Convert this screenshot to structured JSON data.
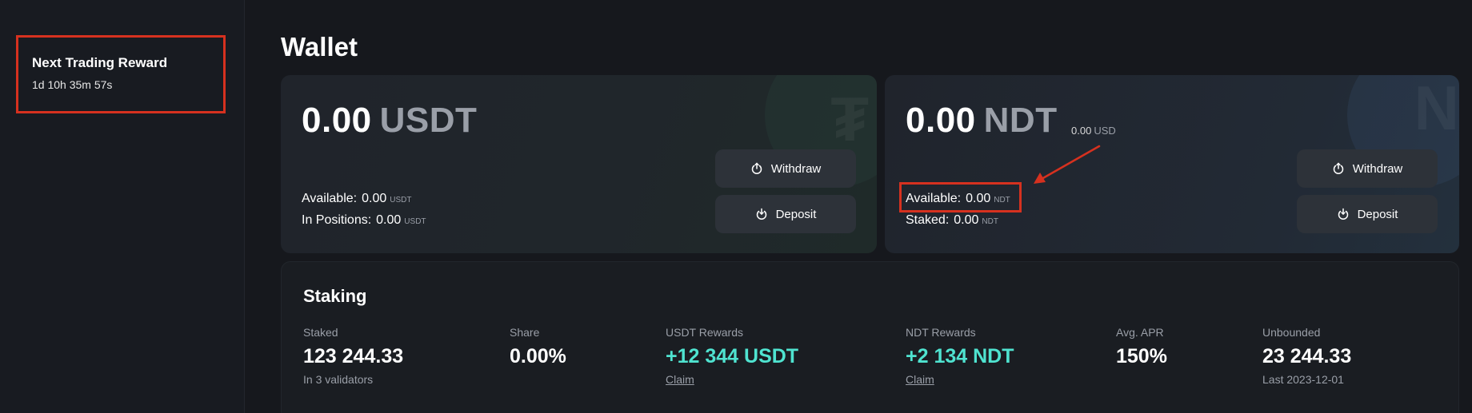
{
  "sidebar": {
    "reward_card": {
      "title": "Next Trading Reward",
      "countdown": "1d 10h 35m 57s"
    }
  },
  "page": {
    "title": "Wallet"
  },
  "wallets": {
    "usdt": {
      "amount": "0.00",
      "currency": "USDT",
      "available_label": "Available:",
      "available_value": "0.00",
      "available_unit": "USDT",
      "positions_label": "In Positions:",
      "positions_value": "0.00",
      "positions_unit": "USDT",
      "withdraw_label": "Withdraw",
      "deposit_label": "Deposit"
    },
    "ndt": {
      "amount": "0.00",
      "currency": "NDT",
      "usd_value": "0.00",
      "usd_label": "USD",
      "available_label": "Available:",
      "available_value": "0.00",
      "available_unit": "NDT",
      "staked_label": "Staked:",
      "staked_value": "0.00",
      "staked_unit": "NDT",
      "withdraw_label": "Withdraw",
      "deposit_label": "Deposit"
    }
  },
  "staking": {
    "title": "Staking",
    "staked": {
      "label": "Staked",
      "value": "123 244.33",
      "sub": "In 3 validators"
    },
    "share": {
      "label": "Share",
      "value": "0.00%"
    },
    "usdt_rewards": {
      "label": "USDT Rewards",
      "value": "+12 344 USDT",
      "link": "Claim"
    },
    "ndt_rewards": {
      "label": "NDT Rewards",
      "value": "+2 134 NDT",
      "link": "Claim"
    },
    "avg_apr": {
      "label": "Avg. APR",
      "value": "150%"
    },
    "unbounded": {
      "label": "Unbounded",
      "value": "23 244.33",
      "sub": "Last 2023-12-01"
    }
  },
  "colors": {
    "accent": "#4fe3d0",
    "highlight": "#d6311f",
    "background": "#16181d"
  },
  "icons": {
    "withdraw": "power-upload-icon",
    "deposit": "power-download-icon"
  }
}
